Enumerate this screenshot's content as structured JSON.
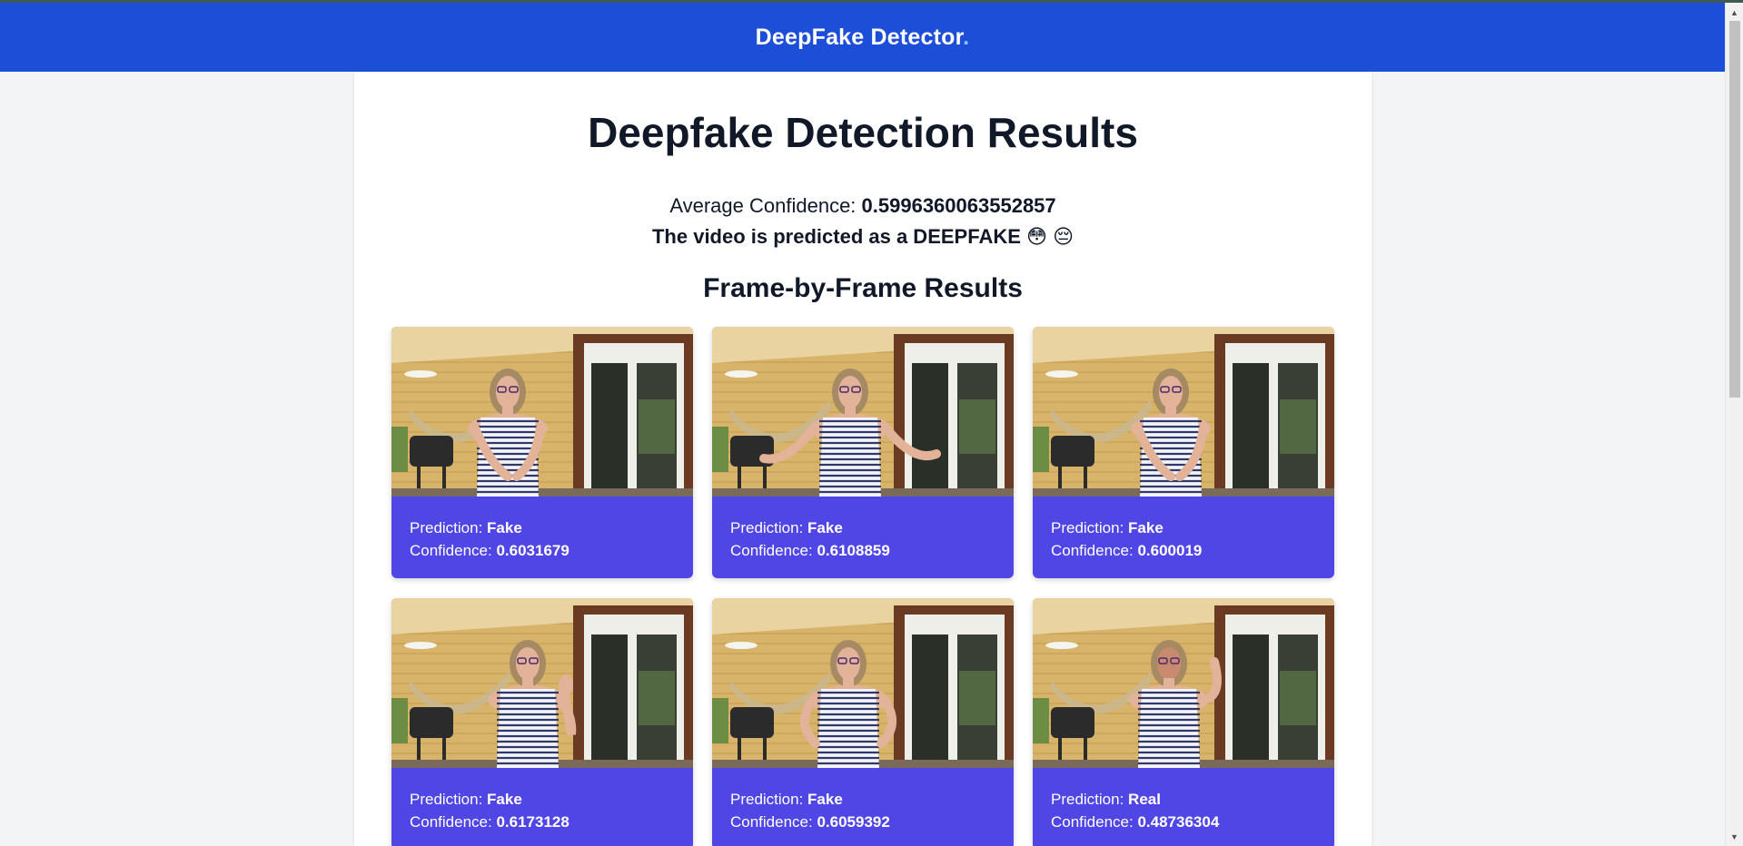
{
  "navbar": {
    "brand": "DeepFake Detector",
    "brand_dot": "."
  },
  "main": {
    "title": "Deepfake Detection Results",
    "avg_label": "Average Confidence: ",
    "avg_value": "0.5996360063552857",
    "verdict_text": "The video is predicted as a DEEPFAKE",
    "verdict_emoji": "😳 😔",
    "section_title": "Frame-by-Frame Results"
  },
  "frames": [
    {
      "prediction_label": "Prediction: ",
      "prediction": "Fake",
      "confidence_label": "Confidence: ",
      "confidence": "0.6031679"
    },
    {
      "prediction_label": "Prediction: ",
      "prediction": "Fake",
      "confidence_label": "Confidence: ",
      "confidence": "0.6108859"
    },
    {
      "prediction_label": "Prediction: ",
      "prediction": "Fake",
      "confidence_label": "Confidence: ",
      "confidence": "0.600019"
    },
    {
      "prediction_label": "Prediction: ",
      "prediction": "Fake",
      "confidence_label": "Confidence: ",
      "confidence": "0.6173128"
    },
    {
      "prediction_label": "Prediction: ",
      "prediction": "Fake",
      "confidence_label": "Confidence: ",
      "confidence": "0.6059392"
    },
    {
      "prediction_label": "Prediction: ",
      "prediction": "Real",
      "confidence_label": "Confidence: ",
      "confidence": "0.48736304"
    }
  ],
  "colors": {
    "navbar": "#1d4ed8",
    "card": "#4f46e5",
    "page_bg": "#f3f4f6"
  }
}
